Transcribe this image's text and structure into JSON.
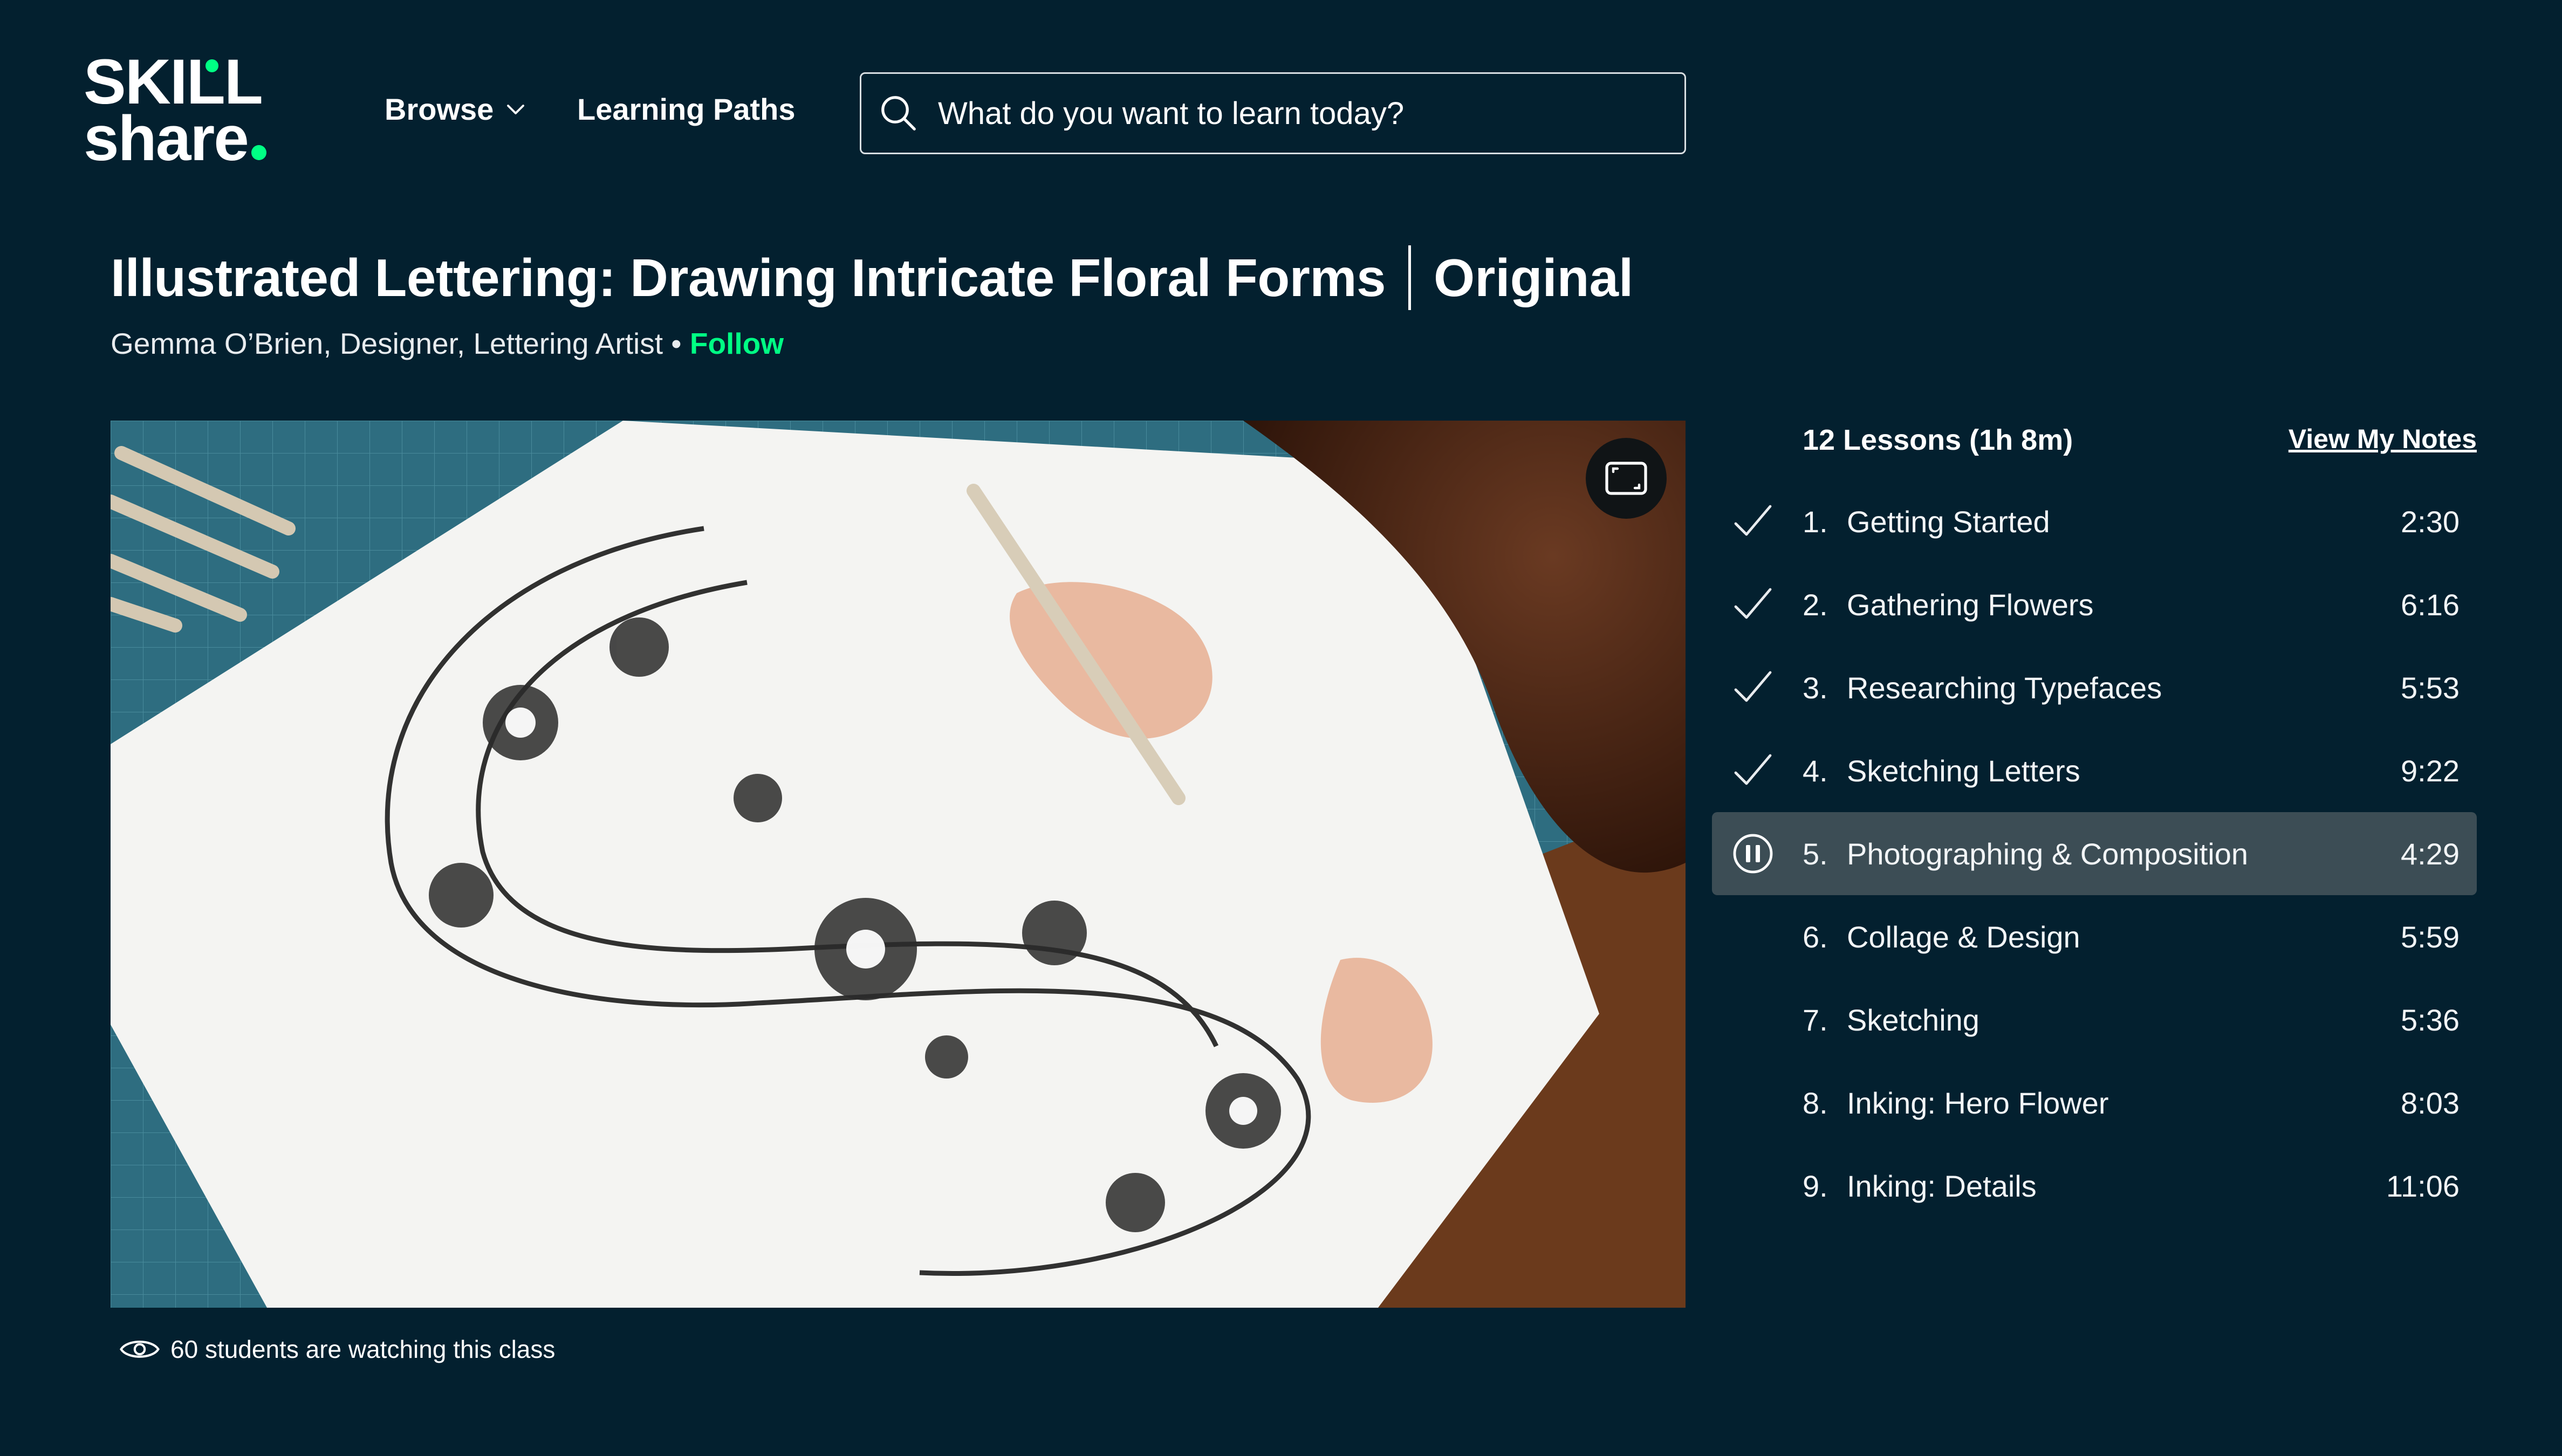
{
  "header": {
    "logo_line1": "SKILL",
    "logo_line2": "share",
    "browse_label": "Browse",
    "learning_paths_label": "Learning Paths",
    "search_placeholder": "What do you want to learn today?",
    "accent_color": "#00ff84"
  },
  "course": {
    "title": "Illustrated Lettering: Drawing Intricate Floral Forms",
    "badge": "Original",
    "author": "Gemma O’Brien, Designer, Lettering Artist",
    "separator": " • ",
    "follow_label": "Follow"
  },
  "video": {
    "watching_text": "60 students are watching this class"
  },
  "lessons": {
    "header": "12 Lessons (1h 8m)",
    "view_notes_label": "View My Notes",
    "items": [
      {
        "num": "1.",
        "name": "Getting Started",
        "duration": "2:30",
        "status": "completed"
      },
      {
        "num": "2.",
        "name": "Gathering Flowers",
        "duration": "6:16",
        "status": "completed"
      },
      {
        "num": "3.",
        "name": "Researching Typefaces",
        "duration": "5:53",
        "status": "completed"
      },
      {
        "num": "4.",
        "name": "Sketching Letters",
        "duration": "9:22",
        "status": "completed"
      },
      {
        "num": "5.",
        "name": "Photographing & Composition",
        "duration": "4:29",
        "status": "playing"
      },
      {
        "num": "6.",
        "name": "Collage & Design",
        "duration": "5:59",
        "status": "none"
      },
      {
        "num": "7.",
        "name": "Sketching",
        "duration": "5:36",
        "status": "none"
      },
      {
        "num": "8.",
        "name": "Inking: Hero Flower",
        "duration": "8:03",
        "status": "none"
      },
      {
        "num": "9.",
        "name": "Inking: Details",
        "duration": "11:06",
        "status": "none"
      }
    ]
  }
}
